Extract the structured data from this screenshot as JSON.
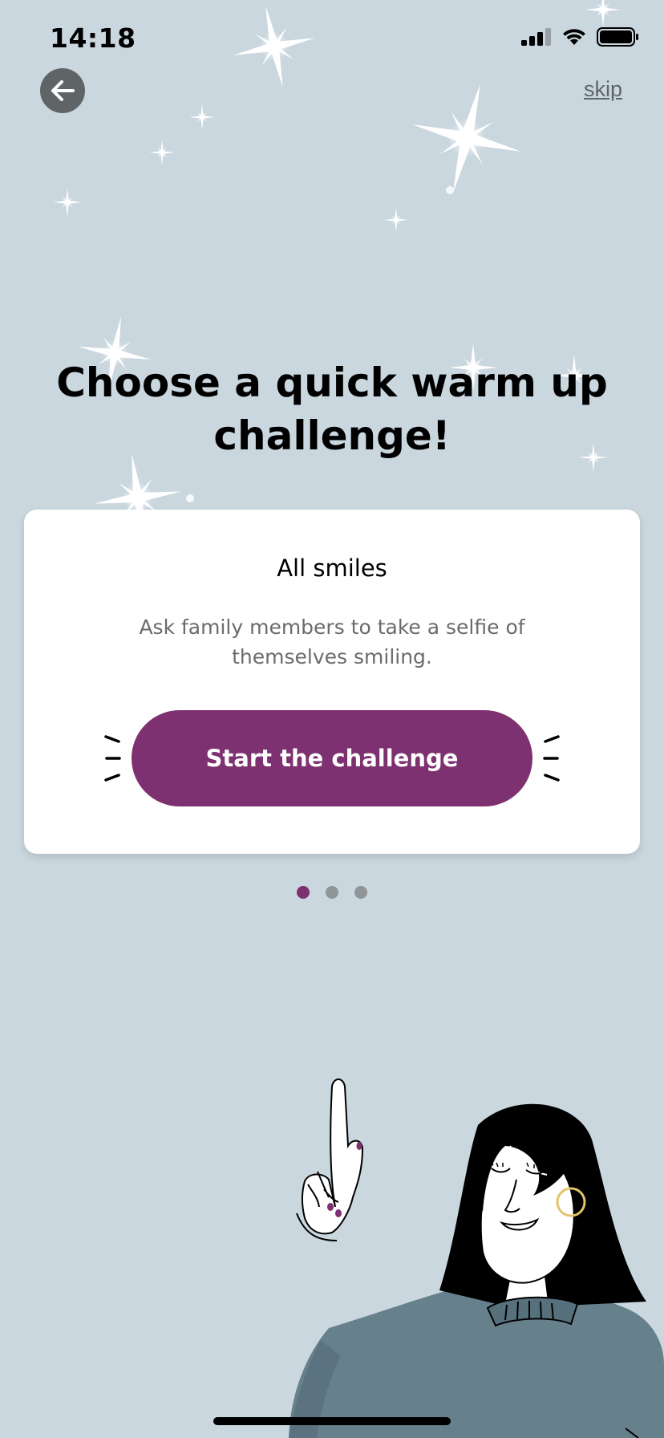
{
  "status_bar": {
    "time": "14:18"
  },
  "nav": {
    "skip_label": "skip"
  },
  "headline": "Choose a quick warm up challenge!",
  "card": {
    "title": "All smiles",
    "description": "Ask family members to take a selfie of themselves smiling.",
    "cta_label": "Start the challenge"
  },
  "pager": {
    "total": 3,
    "active_index": 0
  },
  "colors": {
    "background": "#cad7df",
    "accent": "#7d3170",
    "back_button": "#5f6566",
    "card": "#ffffff"
  }
}
